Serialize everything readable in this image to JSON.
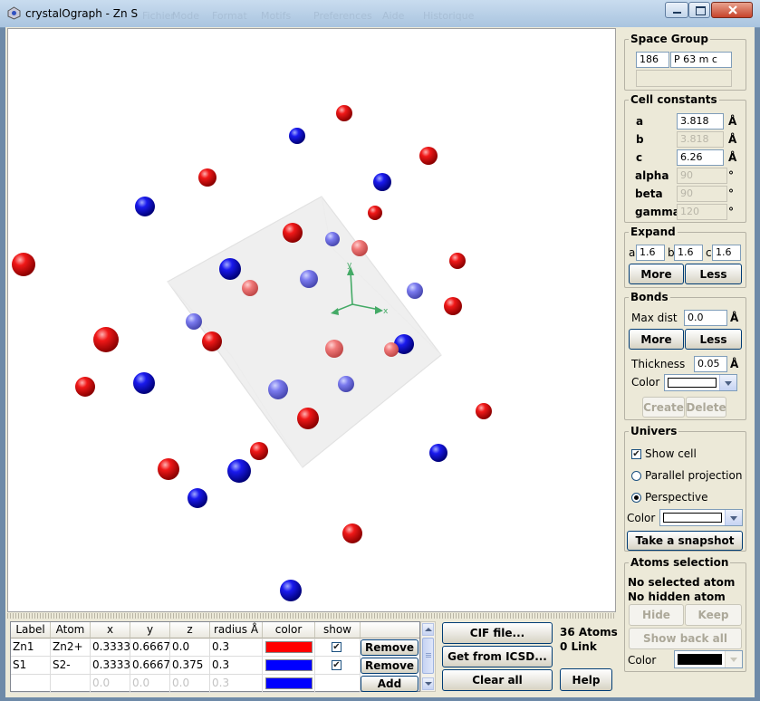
{
  "window": {
    "title": "crystalOgraph - Zn S",
    "menus": [
      "Fichier",
      "Mode",
      "Format",
      "Motifs",
      "Preferences",
      "Aide",
      "Historique"
    ]
  },
  "space_group": {
    "title": "Space Group",
    "number": "186",
    "symbol": "P 63 m c",
    "extra": ""
  },
  "cell": {
    "title": "Cell constants",
    "rows": [
      {
        "name": "a",
        "value": "3.818",
        "unit": "Å",
        "enabled": true
      },
      {
        "name": "b",
        "value": "3.818",
        "unit": "Å",
        "enabled": false
      },
      {
        "name": "c",
        "value": "6.26",
        "unit": "Å",
        "enabled": true
      },
      {
        "name": "alpha",
        "value": "90",
        "unit": "°",
        "enabled": false
      },
      {
        "name": "beta",
        "value": "90",
        "unit": "°",
        "enabled": false
      },
      {
        "name": "gamma",
        "value": "120",
        "unit": "°",
        "enabled": false
      }
    ]
  },
  "expand": {
    "title": "Expand",
    "a_label": "a",
    "a": "1.6",
    "b_label": "b",
    "b": "1.6",
    "c_label": "c",
    "c": "1.6",
    "more": "More",
    "less": "Less"
  },
  "bonds": {
    "title": "Bonds",
    "maxdist_label": "Max dist",
    "maxdist": "0.0",
    "unit": "Å",
    "more": "More",
    "less": "Less",
    "thickness_label": "Thickness",
    "thickness": "0.05",
    "color_label": "Color",
    "color": "#ffffff",
    "create": "Create",
    "delete": "Delete"
  },
  "univers": {
    "title": "Univers",
    "show_cell": "Show cell",
    "show_cell_checked": true,
    "parallel": "Parallel projection",
    "perspective": "Perspective",
    "projection": "perspective",
    "color_label": "Color",
    "color": "#ffffff",
    "snapshot": "Take a snapshot"
  },
  "selection": {
    "title": "Atoms selection",
    "selected": "No selected atom",
    "hidden": "No hidden atom",
    "hide": "Hide",
    "keep": "Keep",
    "show_back": "Show back all",
    "color_label": "Color",
    "color": "#000000"
  },
  "table": {
    "headers": [
      "Label",
      "Atom",
      "x",
      "y",
      "z",
      "radius Å",
      "color",
      "show"
    ],
    "rows": [
      {
        "label": "Zn1",
        "atom": "Zn2+",
        "x": "0.3333",
        "y": "0.6667",
        "z": "0.0",
        "radius": "0.3",
        "color": "#ff0000",
        "show": true,
        "action": "Remove"
      },
      {
        "label": "S1",
        "atom": "S2-",
        "x": "0.3333",
        "y": "0.6667",
        "z": "0.375",
        "radius": "0.3",
        "color": "#0000ff",
        "show": true,
        "action": "Remove"
      }
    ],
    "new_row": {
      "x": "0.0",
      "y": "0.0",
      "z": "0.0",
      "radius": "0.3",
      "color": "#0000ff",
      "action": "Add"
    }
  },
  "actions": {
    "cif": "CIF file...",
    "icsd": "Get from ICSD...",
    "clear": "Clear all",
    "help": "Help"
  },
  "status": {
    "atoms": "36 Atoms",
    "links": "0 Link"
  },
  "axes": {
    "x": "x",
    "y": "y"
  },
  "colors": {
    "zn_atom": "#e01010",
    "s_atom": "#1010e0",
    "accent": "#003c74"
  }
}
